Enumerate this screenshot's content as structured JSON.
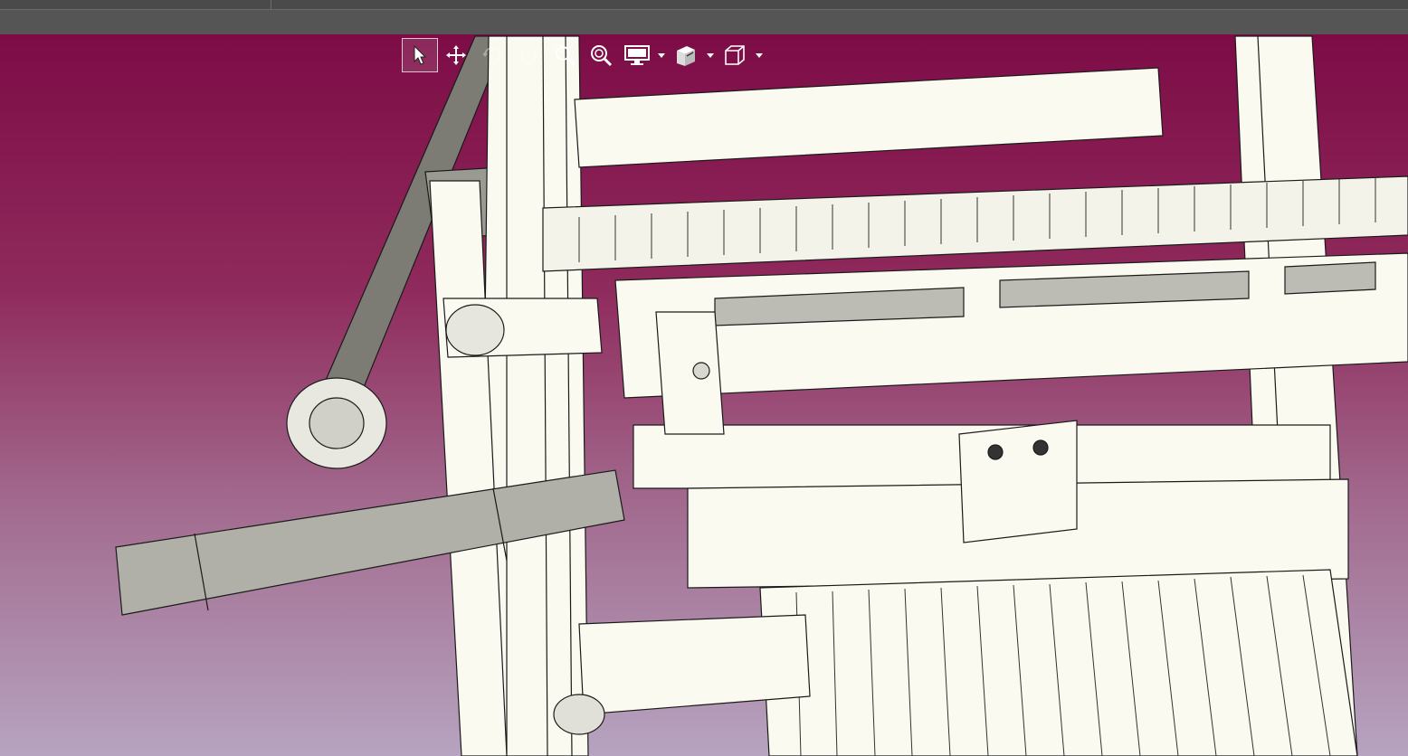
{
  "window": {
    "accent_color": "#7d0c46",
    "viewport_gradient": [
      "#7d0c46",
      "#b6a4c0"
    ]
  },
  "toolbar": {
    "items": [
      {
        "icon": "select-arrow-icon",
        "active": true
      },
      {
        "icon": "pan-move-icon",
        "active": false
      },
      {
        "icon": "rotate-view-icon",
        "active": false,
        "dimmed": true
      },
      {
        "icon": "roll-view-icon",
        "active": false,
        "dimmed": true
      },
      {
        "icon": "zoom-to-area-icon",
        "active": false
      },
      {
        "icon": "zoom-to-fit-icon",
        "active": false
      },
      {
        "icon": "display-style-icon",
        "active": false,
        "has_dropdown": true
      },
      {
        "icon": "hide-show-items-icon",
        "active": false,
        "has_dropdown": true
      },
      {
        "icon": "view-orientation-icon",
        "active": false,
        "has_dropdown": true
      }
    ]
  },
  "model": {
    "part_color": "#fbfaf0",
    "edge_color": "#1a1a1a",
    "shade_color": "#8c8c86"
  }
}
